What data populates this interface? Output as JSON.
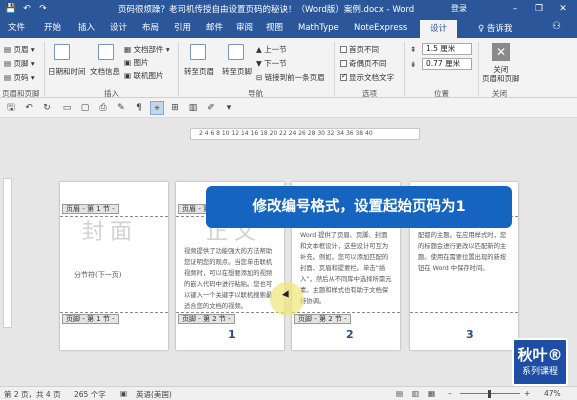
{
  "titlebar": {
    "title": "页码很烦躁？老司机传授自由设置页码的秘诀！（Word版）案例.docx - Word",
    "login": "登录",
    "window_buttons": [
      "–",
      "❐",
      "✕"
    ]
  },
  "tabs": [
    "文件",
    "开始",
    "插入",
    "设计",
    "布局",
    "引用",
    "邮件",
    "审阅",
    "视图",
    "MathType",
    "NoteExpress",
    "设计"
  ],
  "tell_me": "♀ 告诉我",
  "ribbon": {
    "hf_items": [
      "页眉 ▾",
      "页脚 ▾",
      "页码 ▾"
    ],
    "hf_group": "页眉和页脚",
    "insert_items": [
      "日期和时间",
      "文档信息",
      "文档部件 ▾",
      "图片",
      "联机图片"
    ],
    "insert_group": "插入",
    "nav_items": [
      "转至页眉",
      "转至页脚",
      "上一节",
      "下一节",
      "链接到前一条页眉"
    ],
    "nav_group": "导航",
    "options": [
      {
        "label": "首页不同",
        "checked": false
      },
      {
        "label": "奇偶页不同",
        "checked": false
      },
      {
        "label": "显示文档文字",
        "checked": true
      }
    ],
    "options_group": "选项",
    "position": [
      "1.5 厘米",
      "0.77 厘米"
    ],
    "position_group": "位置",
    "close_label": "关闭\n页眉和页脚",
    "close_group": "关闭"
  },
  "ruler": "2  4  6  8  10  12  14  16  18  20  22  24  26  28  30  32  34  36  38  40",
  "pages": [
    {
      "header": "页眉 - 第 1 节 -",
      "footer": "页脚 - 第 1 节 -",
      "big": "封面",
      "body": "",
      "break": "分节符(下一页)",
      "num": ""
    },
    {
      "header": "页眉 - 第 2 节 -",
      "footer": "页脚 - 第 2 节 -",
      "big": "正文",
      "body": "视频提供了功能强大的方法帮助您证明您的观点。当您单击联机视频时，可以在想要添加的视频的嵌入代码中进行粘贴。您也可以键入一个关键字以联机搜索最适合您的文档的视频。",
      "break": "",
      "num": "1"
    },
    {
      "header": "",
      "footer": "页脚 - 第 2 节 -",
      "big": "",
      "body": "Word 提供了页眉、页脚、封面和文本框设计，这些设计可互为补充。例如，您可以添加匹配的封面、页眉和提要栏。单击“插入”，然后从不同库中选择所需元素。主题和样式也有助于文档保持协调。",
      "break": "",
      "num": "2"
    },
    {
      "header": "",
      "footer": "",
      "big": "",
      "body": "配都的主题。在应用样式时，您的标题会进行更改以匹配新的主题。使用在需要位置出现的新按钮在 Word 中保存时间。",
      "break": "",
      "num": "3"
    }
  ],
  "banner": "修改编号格式，设置起始页码为1",
  "logo": {
    "line1": "秋叶®",
    "line2": "系列课程"
  },
  "status": {
    "page": "第 2 页，共 4 页",
    "words": "265 个字",
    "lang": "英语(美国)",
    "zoom": "47%"
  }
}
